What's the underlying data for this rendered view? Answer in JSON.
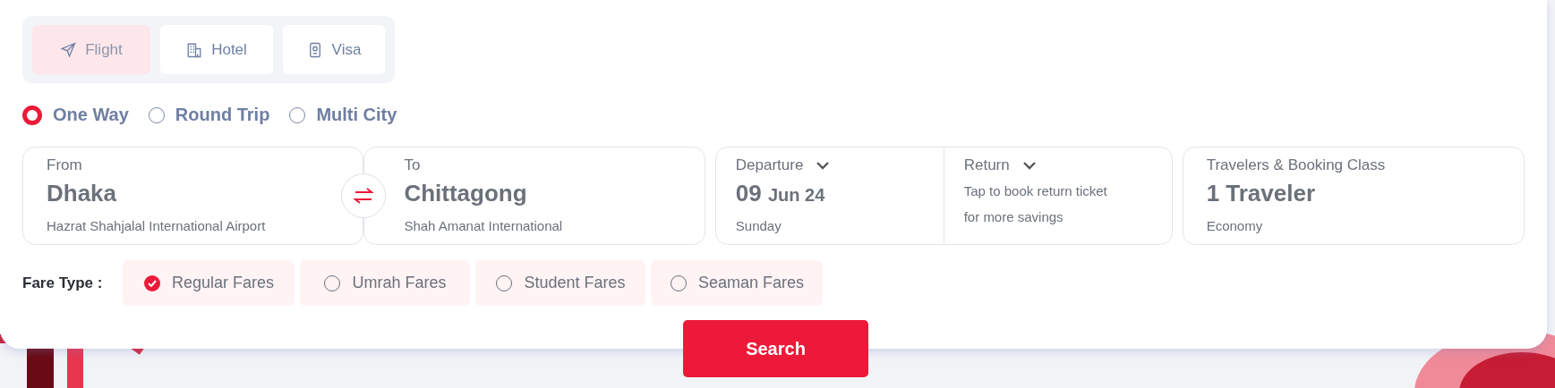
{
  "service_tabs": [
    {
      "kind": "flight",
      "label": "Flight",
      "selected": true
    },
    {
      "kind": "hotel",
      "label": "Hotel",
      "selected": false
    },
    {
      "kind": "visa",
      "label": "Visa",
      "selected": false
    }
  ],
  "trip_types": [
    {
      "label": "One Way",
      "selected": true
    },
    {
      "label": "Round Trip",
      "selected": false
    },
    {
      "label": "Multi City",
      "selected": false
    }
  ],
  "from": {
    "label": "From",
    "city": "Dhaka",
    "airport": "Hazrat Shahjalal International Airport"
  },
  "to": {
    "label": "To",
    "city": "Chittagong",
    "airport": "Shah Amanat International"
  },
  "departure": {
    "label": "Departure",
    "day": "09",
    "month_year": "Jun 24",
    "weekday": "Sunday"
  },
  "return": {
    "label": "Return",
    "hint_line_1": "Tap to book return ticket",
    "hint_line_2": "for more savings"
  },
  "travelers": {
    "label": "Travelers & Booking Class",
    "count": "1 Traveler",
    "class": "Economy"
  },
  "fare_type": {
    "label": "Fare Type :",
    "options": [
      {
        "label": "Regular Fares",
        "selected": true
      },
      {
        "label": "Umrah Fares",
        "selected": false
      },
      {
        "label": "Student Fares",
        "selected": false
      },
      {
        "label": "Seaman Fares",
        "selected": false
      }
    ]
  },
  "search_button": "Search"
}
